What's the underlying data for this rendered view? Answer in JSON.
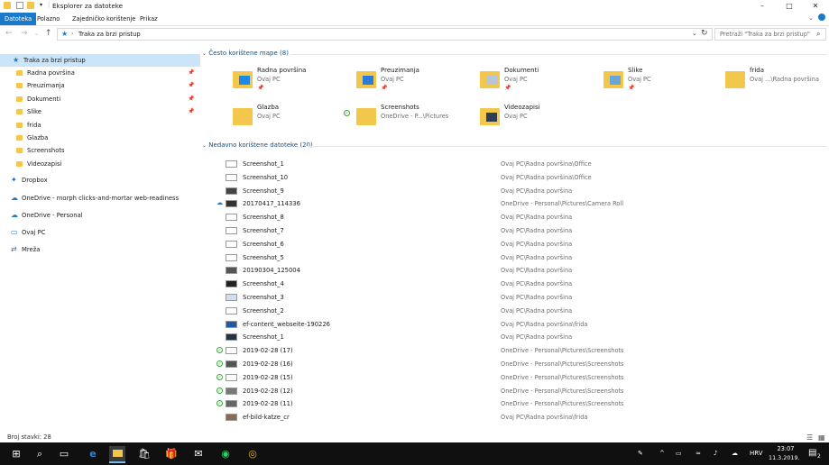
{
  "window": {
    "title": "Eksplorer za datoteke",
    "minimize_icon": "–",
    "maximize_icon": "□",
    "close_icon": "✕"
  },
  "ribbon": {
    "tabs": [
      "Datoteka",
      "Polazno",
      "Zajedničko korištenje",
      "Prikaz"
    ]
  },
  "address": {
    "path": "Traka za brzi pristup",
    "search_placeholder": "Pretraži \"Traka za brzi pristup\""
  },
  "nav": {
    "items": [
      {
        "label": "Traka za brzi pristup",
        "pinned": false
      },
      {
        "label": "Radna površina",
        "pinned": true
      },
      {
        "label": "Preuzimanja",
        "pinned": true
      },
      {
        "label": "Dokumenti",
        "pinned": true
      },
      {
        "label": "Slike",
        "pinned": true
      },
      {
        "label": "frida",
        "pinned": false
      },
      {
        "label": "Glazba",
        "pinned": false
      },
      {
        "label": "Screenshots",
        "pinned": false
      },
      {
        "label": "Videozapisi",
        "pinned": false
      },
      {
        "label": "Dropbox",
        "pinned": false
      },
      {
        "label": "OneDrive - morph clicks-and-mortar web-readiness",
        "pinned": false
      },
      {
        "label": "OneDrive - Personal",
        "pinned": false
      },
      {
        "label": "Ovaj PC",
        "pinned": false
      },
      {
        "label": "Mreža",
        "pinned": false
      }
    ]
  },
  "frequent": {
    "header": "Često korištene mape (8)",
    "folders": [
      {
        "name": "Radna površina",
        "sub": "Ovaj PC"
      },
      {
        "name": "Preuzimanja",
        "sub": "Ovaj PC"
      },
      {
        "name": "Dokumenti",
        "sub": "Ovaj PC"
      },
      {
        "name": "Slike",
        "sub": "Ovaj PC"
      },
      {
        "name": "frida",
        "sub": "Ovaj ...\\Radna površina"
      },
      {
        "name": "Glazba",
        "sub": "Ovaj PC"
      },
      {
        "name": "Screenshots",
        "sub": "OneDrive - P...\\Pictures"
      },
      {
        "name": "Videozapisi",
        "sub": "Ovaj PC"
      }
    ]
  },
  "recent": {
    "header": "Nedavno korištene datoteke (20)",
    "files": [
      {
        "name": "Screenshot_1",
        "path": "Ovaj PC\\Radna površina\\Office"
      },
      {
        "name": "Screenshot_10",
        "path": "Ovaj PC\\Radna površina\\Office"
      },
      {
        "name": "Screenshot_9",
        "path": "Ovaj PC\\Radna površina"
      },
      {
        "name": "20170417_114336",
        "path": "OneDrive - Personal\\Pictures\\Camera Roll"
      },
      {
        "name": "Screenshot_8",
        "path": "Ovaj PC\\Radna površina"
      },
      {
        "name": "Screenshot_7",
        "path": "Ovaj PC\\Radna površina"
      },
      {
        "name": "Screenshot_6",
        "path": "Ovaj PC\\Radna površina"
      },
      {
        "name": "Screenshot_5",
        "path": "Ovaj PC\\Radna površina"
      },
      {
        "name": "20190304_125004",
        "path": "Ovaj PC\\Radna površina"
      },
      {
        "name": "Screenshot_4",
        "path": "Ovaj PC\\Radna površina"
      },
      {
        "name": "Screenshot_3",
        "path": "Ovaj PC\\Radna površina"
      },
      {
        "name": "Screenshot_2",
        "path": "Ovaj PC\\Radna površina"
      },
      {
        "name": "ef-content_webseite-190226",
        "path": "Ovaj PC\\Radna površina\\frida"
      },
      {
        "name": "Screenshot_1",
        "path": "Ovaj PC\\Radna površina"
      },
      {
        "name": "2019-02-28 (17)",
        "path": "OneDrive - Personal\\Pictures\\Screenshots"
      },
      {
        "name": "2019-02-28 (16)",
        "path": "OneDrive - Personal\\Pictures\\Screenshots"
      },
      {
        "name": "2019-02-28 (15)",
        "path": "OneDrive - Personal\\Pictures\\Screenshots"
      },
      {
        "name": "2019-02-28 (12)",
        "path": "OneDrive - Personal\\Pictures\\Screenshots"
      },
      {
        "name": "2019-02-28 (11)",
        "path": "OneDrive - Personal\\Pictures\\Screenshots"
      },
      {
        "name": "ef-bild-katze_cr",
        "path": "Ovaj PC\\Radna površina\\frida"
      }
    ]
  },
  "status": {
    "count": "Broj stavki: 28"
  },
  "taskbar": {
    "language": "HRV",
    "time": "23:07",
    "date": "11.3.2019.",
    "notification_count": "2"
  },
  "colors": {
    "accent": "#1979ca",
    "selection": "#cce4f7",
    "folder": "#f3c64c",
    "section": "#1e4e79"
  }
}
